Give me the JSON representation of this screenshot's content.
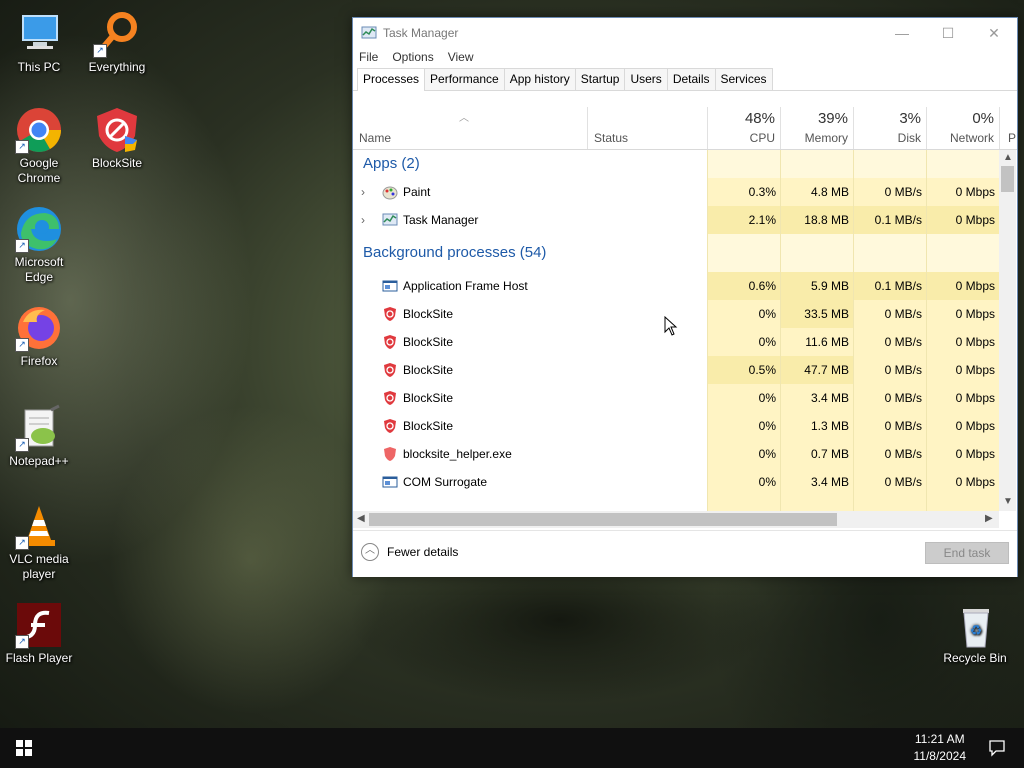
{
  "desktop": {
    "icons": [
      {
        "label": "This PC"
      },
      {
        "label": "Everything"
      },
      {
        "label": "Google Chrome"
      },
      {
        "label": "BlockSite"
      },
      {
        "label": "Microsoft Edge"
      },
      {
        "label": "Firefox"
      },
      {
        "label": "Notepad++"
      },
      {
        "label": "VLC media player"
      },
      {
        "label": "Flash Player"
      },
      {
        "label": "Recycle Bin"
      }
    ]
  },
  "window": {
    "title": "Task Manager",
    "menu": [
      "File",
      "Options",
      "View"
    ],
    "tabs": [
      "Processes",
      "Performance",
      "App history",
      "Startup",
      "Users",
      "Details",
      "Services"
    ],
    "active_tab": "Processes",
    "columns": {
      "name": "Name",
      "status": "Status",
      "cpu": {
        "pct": "48%",
        "label": "CPU"
      },
      "memory": {
        "pct": "39%",
        "label": "Memory"
      },
      "disk": {
        "pct": "3%",
        "label": "Disk"
      },
      "network": {
        "pct": "0%",
        "label": "Network"
      },
      "power_partial": "P"
    },
    "groups": {
      "apps": "Apps (2)",
      "background": "Background processes (54)"
    },
    "apps": [
      {
        "name": "Paint",
        "cpu": "0.3%",
        "memory": "4.8 MB",
        "disk": "0 MB/s",
        "network": "0 Mbps"
      },
      {
        "name": "Task Manager",
        "cpu": "2.1%",
        "memory": "18.8 MB",
        "disk": "0.1 MB/s",
        "network": "0 Mbps"
      }
    ],
    "background": [
      {
        "name": "Application Frame Host",
        "cpu": "0.6%",
        "memory": "5.9 MB",
        "disk": "0.1 MB/s",
        "network": "0 Mbps"
      },
      {
        "name": "BlockSite",
        "cpu": "0%",
        "memory": "33.5 MB",
        "disk": "0 MB/s",
        "network": "0 Mbps"
      },
      {
        "name": "BlockSite",
        "cpu": "0%",
        "memory": "11.6 MB",
        "disk": "0 MB/s",
        "network": "0 Mbps"
      },
      {
        "name": "BlockSite",
        "cpu": "0.5%",
        "memory": "47.7 MB",
        "disk": "0 MB/s",
        "network": "0 Mbps"
      },
      {
        "name": "BlockSite",
        "cpu": "0%",
        "memory": "3.4 MB",
        "disk": "0 MB/s",
        "network": "0 Mbps"
      },
      {
        "name": "BlockSite",
        "cpu": "0%",
        "memory": "1.3 MB",
        "disk": "0 MB/s",
        "network": "0 Mbps"
      },
      {
        "name": "blocksite_helper.exe",
        "cpu": "0%",
        "memory": "0.7 MB",
        "disk": "0 MB/s",
        "network": "0 Mbps"
      },
      {
        "name": "COM Surrogate",
        "cpu": "0%",
        "memory": "3.4 MB",
        "disk": "0 MB/s",
        "network": "0 Mbps"
      }
    ],
    "footer": {
      "fewer_details": "Fewer details",
      "end_task": "End task"
    }
  },
  "taskbar": {
    "time": "11:21 AM",
    "date": "11/8/2024"
  }
}
